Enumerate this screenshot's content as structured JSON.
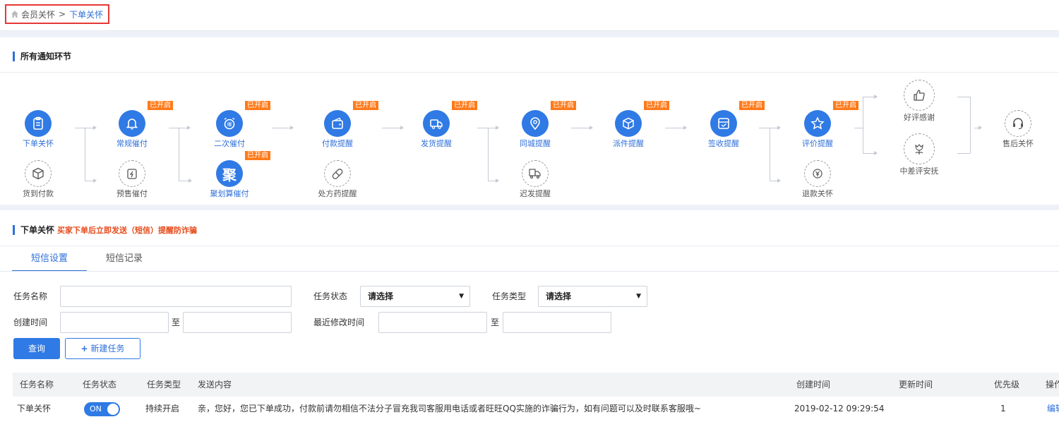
{
  "breadcrumb": {
    "parent": "会员关怀",
    "separator": ">",
    "current": "下单关怀"
  },
  "flow": {
    "title": "所有通知环节",
    "badge": "已开启",
    "nodes": {
      "order": "下单关怀",
      "cod": "货到付款",
      "regular_remind": "常规催付",
      "presale_remind": "预售催付",
      "second_remind": "二次催付",
      "juhs_remind": "聚划算催付",
      "juhs_char": "聚",
      "payment": "付款提醒",
      "prescription": "处方药提醒",
      "shipping": "发货提醒",
      "same_city": "同城提醒",
      "delay": "迟发提醒",
      "dispatch": "派件提醒",
      "sign": "签收提醒",
      "review": "评价提醒",
      "refund": "退款关怀",
      "good_review": "好评感谢",
      "bad_review": "中差评安抚",
      "after_sale": "售后关怀"
    }
  },
  "detail": {
    "title": "下单关怀",
    "hint": "买家下单后立即发送（短信）提醒防诈骗"
  },
  "tabs": [
    {
      "label": "短信设置",
      "active": true
    },
    {
      "label": "短信记录",
      "active": false
    }
  ],
  "form": {
    "task_name_label": "任务名称",
    "task_status_label": "任务状态",
    "task_status_value": "请选择",
    "task_type_label": "任务类型",
    "task_type_value": "请选择",
    "created_label": "创建时间",
    "to": "至",
    "modified_label": "最近修改时间",
    "query": "查询",
    "new_task": "新建任务"
  },
  "table": {
    "headers": {
      "name": "任务名称",
      "status": "任务状态",
      "type": "任务类型",
      "content": "发送内容",
      "created": "创建时间",
      "updated": "更新时间",
      "priority": "优先级",
      "ops": "操作"
    },
    "rows": [
      {
        "name": "下单关怀",
        "status": "ON",
        "type": "持续开启",
        "content": "亲，您好，您已下单成功，付款前请勿相信不法分子冒充我司客服用电话或者旺旺QQ实施的诈骗行为，如有问题可以及时联系客服哦~",
        "created": "2019-02-12 09:29:54",
        "updated": "",
        "priority": "1",
        "op": "编辑"
      }
    ]
  },
  "colors": {
    "primary": "#2f7ae5",
    "badge": "#ff7a1a",
    "hint": "#e64a19",
    "crumb_border": "#e53935"
  }
}
